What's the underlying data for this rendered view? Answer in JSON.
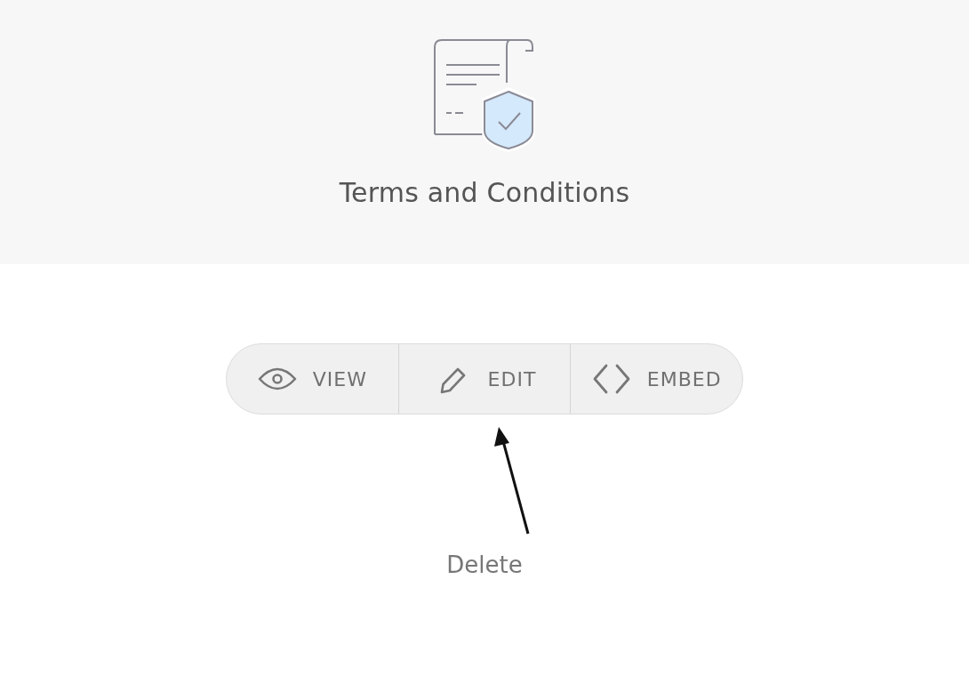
{
  "header": {
    "title": "Terms and Conditions"
  },
  "actions": [
    {
      "kind": "eye",
      "label": "VIEW"
    },
    {
      "kind": "pencil",
      "label": "EDIT"
    },
    {
      "kind": "code",
      "label": "EMBED"
    }
  ],
  "delete_link": "Delete"
}
